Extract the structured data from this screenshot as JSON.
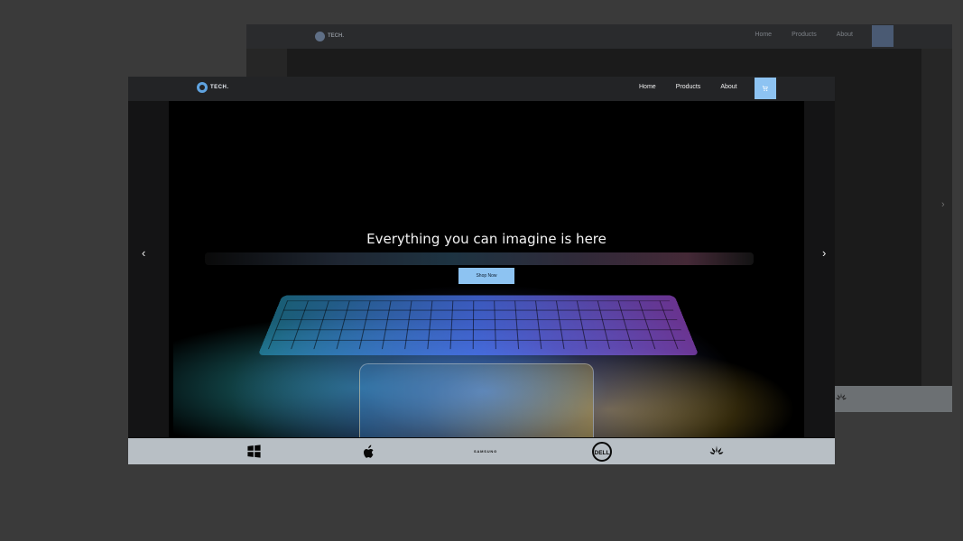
{
  "background_window": {
    "brand": "TECH.",
    "nav_links": [
      "Home",
      "Products",
      "About"
    ]
  },
  "site": {
    "brand": "TECH.",
    "nav_links": [
      "Home",
      "Products",
      "About"
    ]
  },
  "hero": {
    "headline": "Everything you can imagine is here",
    "button_label": "Shop Now",
    "prev_label": "‹",
    "next_label": "›"
  },
  "brand_bar": {
    "samsung_label": "SAMSUNG",
    "brands": [
      "windows-icon",
      "apple-icon",
      "samsung-logo",
      "dell-logo",
      "huawei-logo"
    ]
  },
  "colors": {
    "accent": "#8dc3f2",
    "page_bg": "#3a3a3a",
    "nav_bg": "#232426",
    "brand_bar_bg": "#b8bfc5"
  }
}
